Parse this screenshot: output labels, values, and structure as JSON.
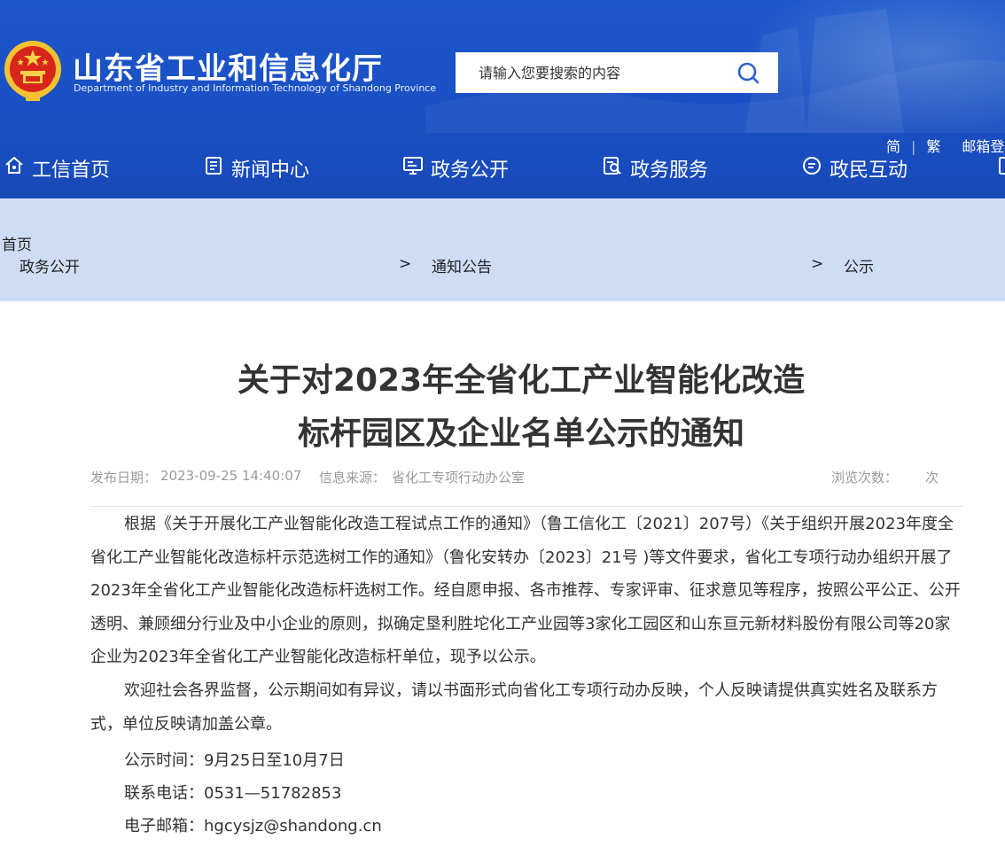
{
  "header": {
    "site_title": "山东省工业和信息化厅",
    "site_subtitle": "Department of Industry and Information Technology of Shandong Province",
    "search_placeholder": "请输入您要搜索的内容",
    "util_links": [
      "简",
      "繁",
      "邮箱登录"
    ],
    "nav": [
      "工信首页",
      "新闻中心",
      "政务公开",
      "政务服务",
      "政民互动"
    ]
  },
  "breadcrumb": {
    "items": [
      "首页",
      "政务公开",
      "通知公告",
      "公示"
    ],
    "separator": ">"
  },
  "article": {
    "title_lines": [
      "关于对2023年全省化工产业智能化改造",
      "标杆园区及企业名单公示的通知"
    ],
    "publish_label": "发布日期：",
    "publish_date": "2023-09-25 14:40:07",
    "source_label": "信息来源：",
    "source": "省化工专项行动办公室",
    "views_label": "浏览次数：",
    "views_unit": "次",
    "paragraphs": [
      "根据《关于开展化工产业智能化改造工程试点工作的通知》（鲁工信化工〔2021〕207号）《关于组织开展2023年度全省化工产业智能化改造标杆示范选树工作的通知》（鲁化安转办〔2023〕21号 )等文件要求，省化工专项行动办组织开展了2023年全省化工产业智能化改造标杆选树工作。经自愿申报、各市推荐、专家评审、征求意见等程序，按照公平公正、公开透明、兼顾细分行业及中小企业的原则，拟确定垦利胜坨化工产业园等3家化工园区和山东亘元新材料股份有限公司等20家企业为2023年全省化工产业智能化改造标杆单位，现予以公示。",
      "欢迎社会各界监督，公示期间如有异议，请以书面形式向省化工专项行动办反映，个人反映请提供真实姓名及联系方式，单位反映请加盖公章。"
    ],
    "contact_lines": [
      "公示时间：9月25日至10月7日",
      "联系电话：0531—51782853",
      "电子邮箱：hgcysjz@shandong.cn"
    ]
  }
}
